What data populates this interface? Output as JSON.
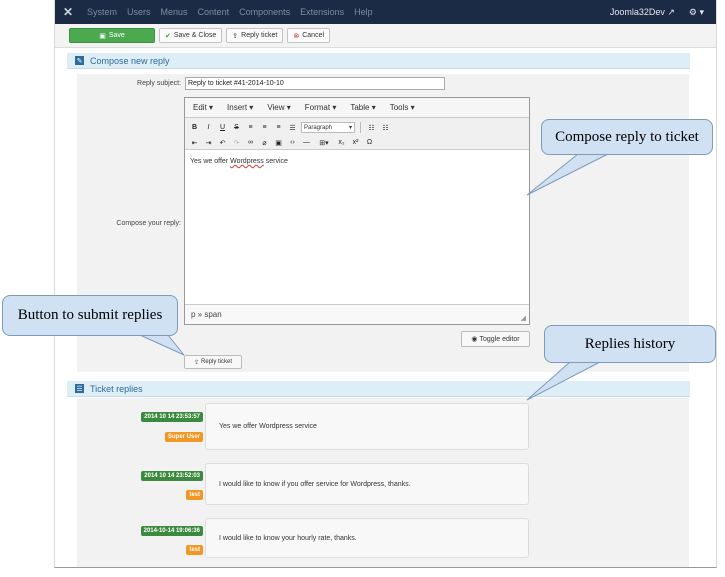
{
  "topnav": {
    "menu": [
      "System",
      "Users",
      "Menus",
      "Content",
      "Components",
      "Extensions",
      "Help"
    ],
    "site_name": "Joomla32Dev",
    "settings_icon": "gear-icon"
  },
  "toolbar": {
    "save_label": "Save",
    "save_close_label": "Save & Close",
    "reply_ticket_label": "Reply ticket",
    "cancel_label": "Cancel"
  },
  "compose": {
    "section_title": "Compose new reply",
    "subject_label": "Reply subject:",
    "subject_value": "Reply to ticket #41-2014-10-10",
    "reply_label": "Compose your reply:",
    "editor_menus": [
      "Edit",
      "Insert",
      "View",
      "Format",
      "Table",
      "Tools"
    ],
    "paragraph_select": "Paragraph",
    "content": "Yes we offer Wordpress service",
    "content_prefix": "Yes we offer ",
    "content_misspelled": "Wordpress",
    "content_suffix": " service",
    "path": "p » span",
    "toggle_editor_label": "Toggle editor",
    "reply_button_label": "Reply ticket"
  },
  "replies": {
    "section_title": "Ticket replies",
    "items": [
      {
        "date": "2014 10 14 23:53:57",
        "user": "Super User",
        "message": "Yes we offer Wordpress service"
      },
      {
        "date": "2014 10 14 23:52:03",
        "user": "test",
        "message": "I would like to know if you offer service for Wordpress, thanks."
      },
      {
        "date": "2014-10-14 19:06:36",
        "user": "test",
        "message": "I would like to know your hourly rate, thanks."
      }
    ]
  },
  "callouts": {
    "compose": "Compose reply to ticket",
    "submit": "Button to submit replies",
    "history": "Replies history"
  },
  "colors": {
    "nav_bg": "#1b2b45",
    "save_green": "#4ba94f",
    "date_green": "#3c8a3f",
    "user_orange": "#f29624",
    "section_blue": "#ddeef7",
    "callout_fill": "#cfe1f3"
  }
}
